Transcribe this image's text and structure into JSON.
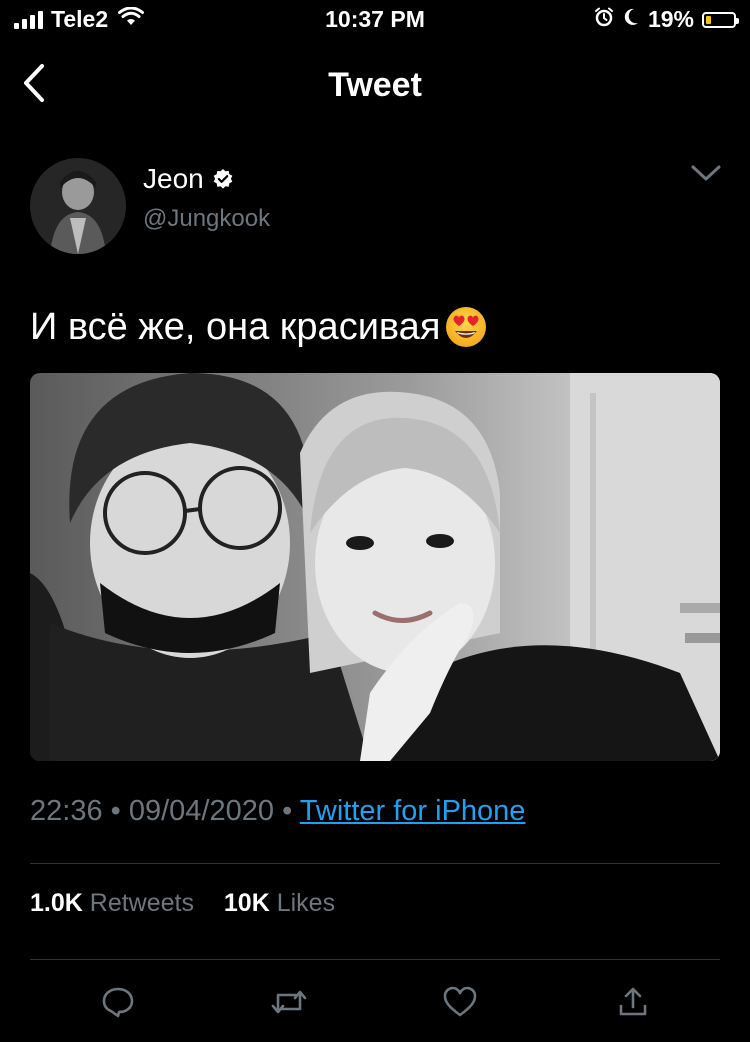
{
  "status_bar": {
    "carrier": "Tele2",
    "time": "10:37 PM",
    "battery_percent": "19%",
    "battery_level": 0.19,
    "icons": [
      "signal-icon",
      "wifi-icon",
      "alarm-icon",
      "moon-icon",
      "battery-icon"
    ]
  },
  "header": {
    "title": "Tweet",
    "back_icon": "chevron-left-icon"
  },
  "author": {
    "name": "Jeon",
    "handle": "@Jungkook",
    "verified_icon": "verified-badge-icon",
    "menu_icon": "chevron-down-icon"
  },
  "tweet": {
    "text": "И всё же, она красивая",
    "emoji": "heart-eyes-emoji-icon",
    "time": "22:36",
    "separator": "•",
    "date": "09/04/2020",
    "source": "Twitter for iPhone"
  },
  "stats": {
    "retweets_count": "1.0K",
    "retweets_label": "Retweets",
    "likes_count": "10K",
    "likes_label": "Likes"
  },
  "actions": {
    "reply_icon": "reply-icon",
    "retweet_icon": "retweet-icon",
    "like_icon": "heart-icon",
    "share_icon": "share-icon"
  },
  "colors": {
    "background": "#000000",
    "text": "#ffffff",
    "secondary_text": "#6e767d",
    "link": "#1da1f2",
    "divider": "#2f3336",
    "battery": "#f5c518"
  }
}
